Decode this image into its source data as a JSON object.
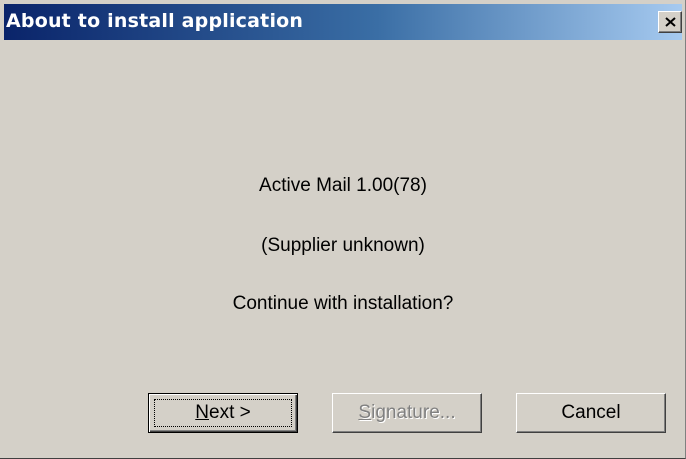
{
  "window": {
    "title": "About to install application",
    "close_glyph": "close-icon"
  },
  "message": {
    "app_name": "Active Mail 1.00(78)",
    "supplier": "(Supplier unknown)",
    "question": "Continue with installation?"
  },
  "buttons": {
    "next": {
      "mnemonic": "N",
      "rest": "ext >",
      "enabled": true,
      "focused": true
    },
    "signature": {
      "mnemonic": "S",
      "rest": "ignature...",
      "enabled": false
    },
    "cancel": {
      "label": "Cancel",
      "enabled": true
    }
  },
  "colors": {
    "face": "#d4d0c8",
    "title_start": "#0a246a",
    "title_end": "#a6caf0",
    "disabled_text": "#808080"
  }
}
